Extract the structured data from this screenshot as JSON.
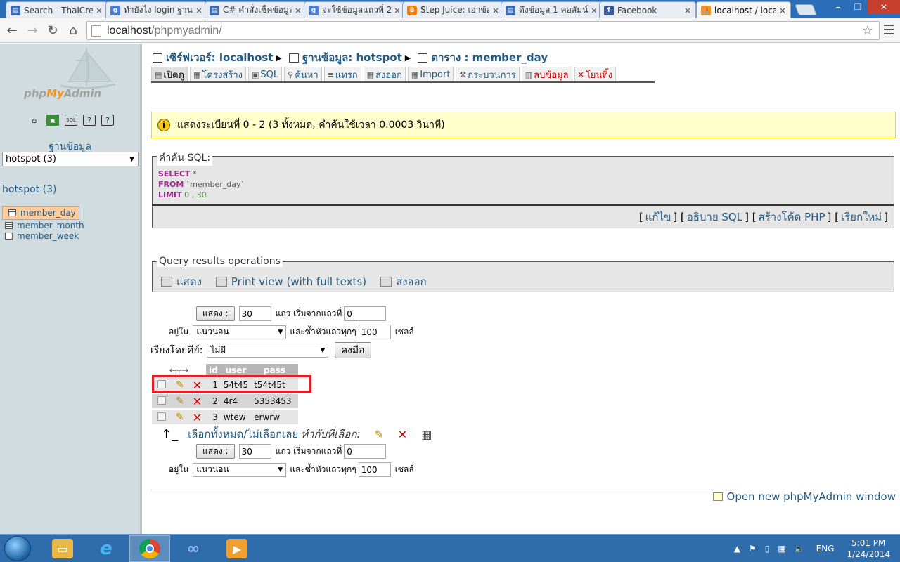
{
  "browser": {
    "tabs": [
      {
        "title": "Search - ThaiCre",
        "icon": "page-icon",
        "color": "#3b6cb4"
      },
      {
        "title": "ทำยังไง login ฐาน",
        "icon": "google-icon",
        "color": "#4a7fd9"
      },
      {
        "title": "C# คำสั่งเช็คข้อมูล",
        "icon": "page-icon",
        "color": "#3b6cb4"
      },
      {
        "title": "จะใช้ข้อมูลแถวที่ 2",
        "icon": "google-icon",
        "color": "#4a7fd9"
      },
      {
        "title": "Step Juice: เอาข้อ",
        "icon": "blogger-icon",
        "color": "#f57d00"
      },
      {
        "title": "ดึงข้อมูล 1 คอลัมน์",
        "icon": "page-icon",
        "color": "#3b6cb4"
      },
      {
        "title": "Facebook",
        "icon": "facebook-icon",
        "color": "#3b5998"
      },
      {
        "title": "localhost / local",
        "icon": "pma-icon",
        "color": "#f29419"
      }
    ],
    "close_glyph": "×",
    "url_host": "localhost",
    "url_path": "/phpmyadmin/"
  },
  "sidebar": {
    "logo_php": "php",
    "logo_my": "My",
    "logo_admin": "Admin",
    "db_label": "ฐานข้อมูล",
    "db_select": "hotspot (3)",
    "db_title": "hotspot (3)",
    "tables": [
      "member_day",
      "member_month",
      "member_week"
    ]
  },
  "breadcrumb": {
    "server": "เซิร์ฟเวอร์: localhost",
    "database": "ฐานข้อมูล: hotspot",
    "table": "ตาราง : member_day"
  },
  "tabs": [
    {
      "label": "เปิดดู",
      "icon": "browse-icon"
    },
    {
      "label": "โครงสร้าง",
      "icon": "structure-icon"
    },
    {
      "label": "SQL",
      "icon": "sql-icon"
    },
    {
      "label": "ค้นหา",
      "icon": "search-icon"
    },
    {
      "label": "แทรก",
      "icon": "insert-icon"
    },
    {
      "label": "ส่งออก",
      "icon": "export-icon"
    },
    {
      "label": "Import",
      "icon": "import-icon"
    },
    {
      "label": "กระบวนการ",
      "icon": "operations-icon"
    },
    {
      "label": "ลบข้อมูล",
      "icon": "empty-icon"
    },
    {
      "label": "โยนทิ้ง",
      "icon": "drop-icon"
    }
  ],
  "notice": "แสดงระเบียนที่ 0 - 2 (3 ทั้งหมด, คำค้นใช้เวลา 0.0003 วินาที)",
  "sql_box": {
    "legend": "คำค้น SQL:",
    "line1_kw": "SELECT",
    "line1_rest": " *",
    "line2_kw": "FROM",
    "line2_rest": " `member_day`",
    "line3_kw": "LIMIT",
    "line3_rest": " 0 , 30",
    "links": [
      "แก้ไข",
      "อธิบาย SQL",
      "สร้างโค้ด PHP",
      "เรียกใหม่"
    ]
  },
  "query_ops": {
    "legend": "Query results operations",
    "items": [
      "แสดง",
      "Print view (with full texts)",
      "ส่งออก"
    ]
  },
  "nav": {
    "show_btn": "แสดง :",
    "rows_value": "30",
    "rows_label": "แถว เริ่มจากแถวที่",
    "start_value": "0",
    "in_label": "อยู่ใน",
    "mode_value": "แนวนอน",
    "repeat_label": "และซ้ำหัวแถวทุกๆ",
    "repeat_value": "100",
    "cells_label": "เซลล์",
    "sort_label": "เรียงโดยคีย์:",
    "sort_value": "ไม่มี",
    "go_btn": "ลงมือ"
  },
  "result_table": {
    "columns": [
      "id",
      "user",
      "pass"
    ],
    "rows": [
      {
        "id": "1",
        "user": "54t45",
        "pass": "t54t45t"
      },
      {
        "id": "2",
        "user": "4r4",
        "pass": "5353453"
      },
      {
        "id": "3",
        "user": "wtew",
        "pass": "erwrw"
      }
    ],
    "highlight_color": "#e21f26"
  },
  "with_selected": {
    "check_all": "เลือกทั้งหมด",
    "sep": " / ",
    "uncheck_all": "ไม่เลือกเลย",
    "label": "ทำกับที่เลือก:"
  },
  "footer": {
    "new_window": "Open new phpMyAdmin window"
  },
  "taskbar": {
    "lang": "ENG",
    "time": "5:01 PM",
    "date": "1/24/2014"
  }
}
